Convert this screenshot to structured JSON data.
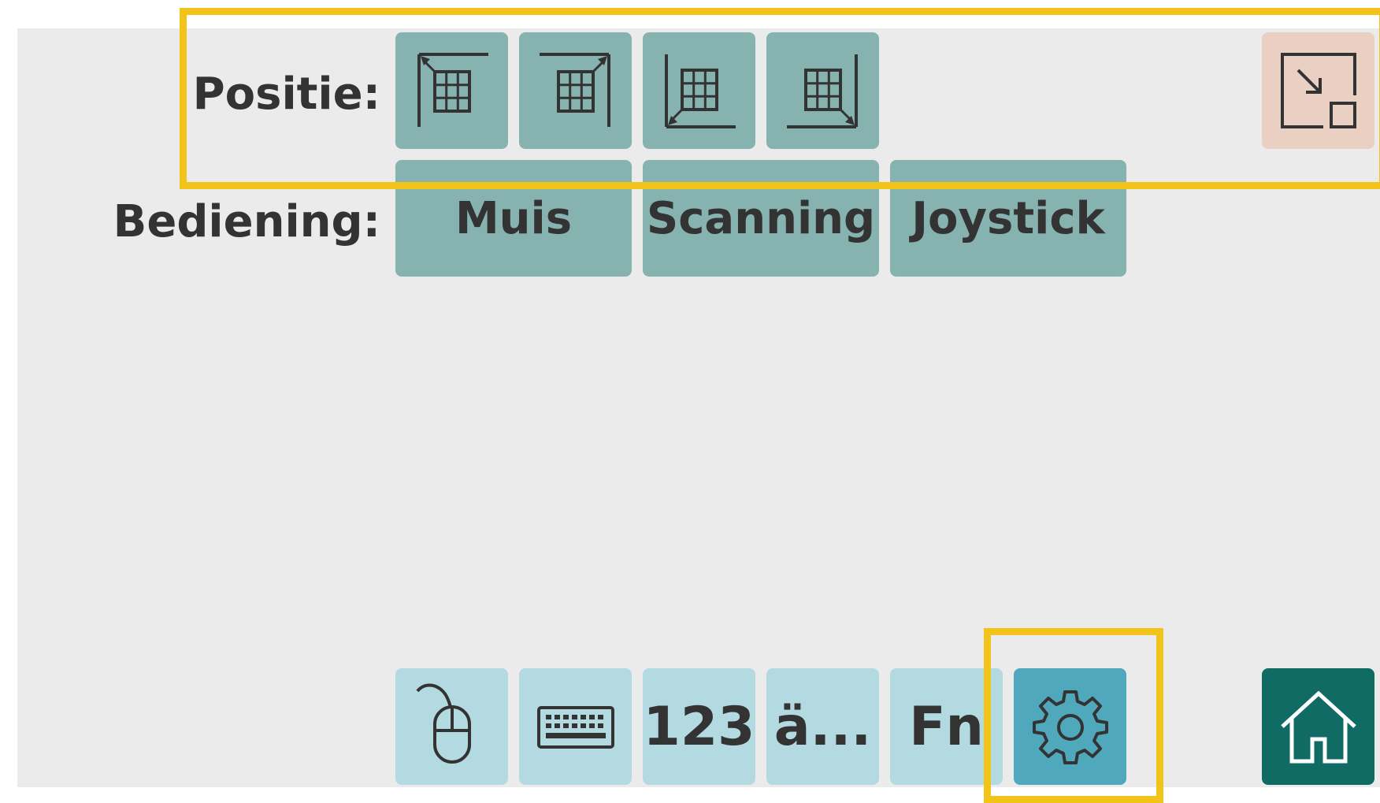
{
  "colors": {
    "panel_bg": "#ebebeb",
    "position_button_bg": "#86b3b0",
    "mode_button_bg": "#86b3b0",
    "bottom_button_bg": "#b3dae1",
    "bottom_button_active_bg": "#50a8bd",
    "resize_button_bg": "#ead0c3",
    "home_button_bg": "#0f6b63",
    "highlight": "#f2c318",
    "text": "#333333"
  },
  "position": {
    "label": "Positie:",
    "buttons": [
      {
        "icon": "grid-top-left-icon"
      },
      {
        "icon": "grid-top-right-icon"
      },
      {
        "icon": "grid-bottom-left-icon"
      },
      {
        "icon": "grid-bottom-right-icon"
      }
    ],
    "resize_icon": "resize-shrink-icon"
  },
  "control": {
    "label": "Bediening:",
    "modes": [
      "Muis",
      "Scanning",
      "Joystick"
    ]
  },
  "bottom_bar": {
    "items": [
      {
        "icon": "mouse-icon"
      },
      {
        "icon": "keyboard-icon"
      },
      {
        "label": "123"
      },
      {
        "label": "ä..."
      },
      {
        "label": "Fn"
      },
      {
        "icon": "gear-icon",
        "active": true
      }
    ],
    "home_icon": "home-icon"
  }
}
